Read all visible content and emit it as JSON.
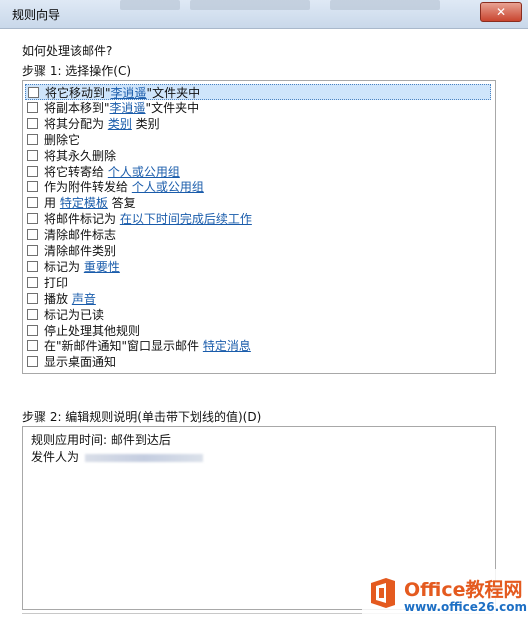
{
  "window": {
    "title": "规则向导",
    "close_symbol": "✕"
  },
  "step1": {
    "question": "如何处理该邮件?",
    "label": "步骤 1: 选择操作(C)"
  },
  "actions": [
    {
      "pre": "将它移动到\"",
      "link": "李逍遥",
      "post": "\"文件夹中",
      "selected": true
    },
    {
      "pre": "将副本移到\"",
      "link": "李逍遥",
      "post": "\"文件夹中"
    },
    {
      "pre": "将其分配为 ",
      "link": "类别",
      "post": " 类别"
    },
    {
      "pre": "删除它",
      "link": "",
      "post": ""
    },
    {
      "pre": "将其永久删除",
      "link": "",
      "post": ""
    },
    {
      "pre": "将它转寄给 ",
      "link": "个人或公用组",
      "post": ""
    },
    {
      "pre": "作为附件转发给 ",
      "link": "个人或公用组",
      "post": ""
    },
    {
      "pre": "用 ",
      "link": "特定模板",
      "post": " 答复"
    },
    {
      "pre": "将邮件标记为 ",
      "link": "在以下时间完成后续工作",
      "post": ""
    },
    {
      "pre": "清除邮件标志",
      "link": "",
      "post": ""
    },
    {
      "pre": "清除邮件类别",
      "link": "",
      "post": ""
    },
    {
      "pre": "标记为 ",
      "link": "重要性",
      "post": ""
    },
    {
      "pre": "打印",
      "link": "",
      "post": ""
    },
    {
      "pre": "播放 ",
      "link": "声音",
      "post": ""
    },
    {
      "pre": "标记为已读",
      "link": "",
      "post": ""
    },
    {
      "pre": "停止处理其他规则",
      "link": "",
      "post": ""
    },
    {
      "pre": "在\"新邮件通知\"窗口显示邮件 ",
      "link": "特定消息",
      "post": ""
    },
    {
      "pre": "显示桌面通知",
      "link": "",
      "post": ""
    }
  ],
  "step2": {
    "label": "步骤 2: 编辑规则说明(单击带下划线的值)(D)",
    "line1": "规则应用时间: 邮件到达后",
    "line2": "发件人为"
  },
  "watermark": {
    "brand": "Office教程网",
    "url": "www.office26.com",
    "colors": {
      "brand": "#e45a1f",
      "url": "#1d6fc4"
    }
  }
}
